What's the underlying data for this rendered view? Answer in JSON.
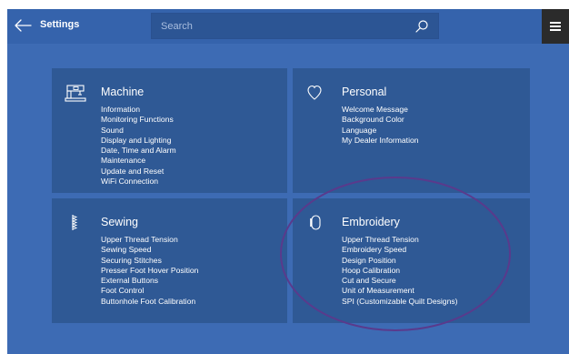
{
  "header": {
    "title": "Settings",
    "search_placeholder": "Search"
  },
  "panels": {
    "machine": {
      "title": "Machine",
      "icon": "sewing-machine-icon",
      "items": [
        "Information",
        "Monitoring Functions",
        "Sound",
        "Display and Lighting",
        "Date, Time and Alarm",
        "Maintenance",
        "Update and Reset",
        "WiFi Connection"
      ]
    },
    "personal": {
      "title": "Personal",
      "icon": "heart-icon",
      "items": [
        "Welcome Message",
        "Background Color",
        "Language",
        "My Dealer Information"
      ]
    },
    "sewing": {
      "title": "Sewing",
      "icon": "stitch-icon",
      "items": [
        "Upper Thread Tension",
        "Sewing Speed",
        "Securing Stitches",
        "Presser Foot Hover Position",
        "External Buttons",
        "Foot Control",
        "Buttonhole Foot Calibration"
      ]
    },
    "embroidery": {
      "title": "Embroidery",
      "icon": "embroidery-hoop-icon",
      "items": [
        "Upper Thread Tension",
        "Embroidery Speed",
        "Design Position",
        "Hoop Calibration",
        "Cut and Secure",
        "Unit of Measurement",
        "SPI (Customizable Quilt Designs)"
      ]
    }
  },
  "colors": {
    "background": "#3d6bb4",
    "panel": "#2f5995",
    "search_field": "#2c5594",
    "menu_button": "#2b2b2b",
    "highlight_ellipse": "#5a3a8c"
  }
}
